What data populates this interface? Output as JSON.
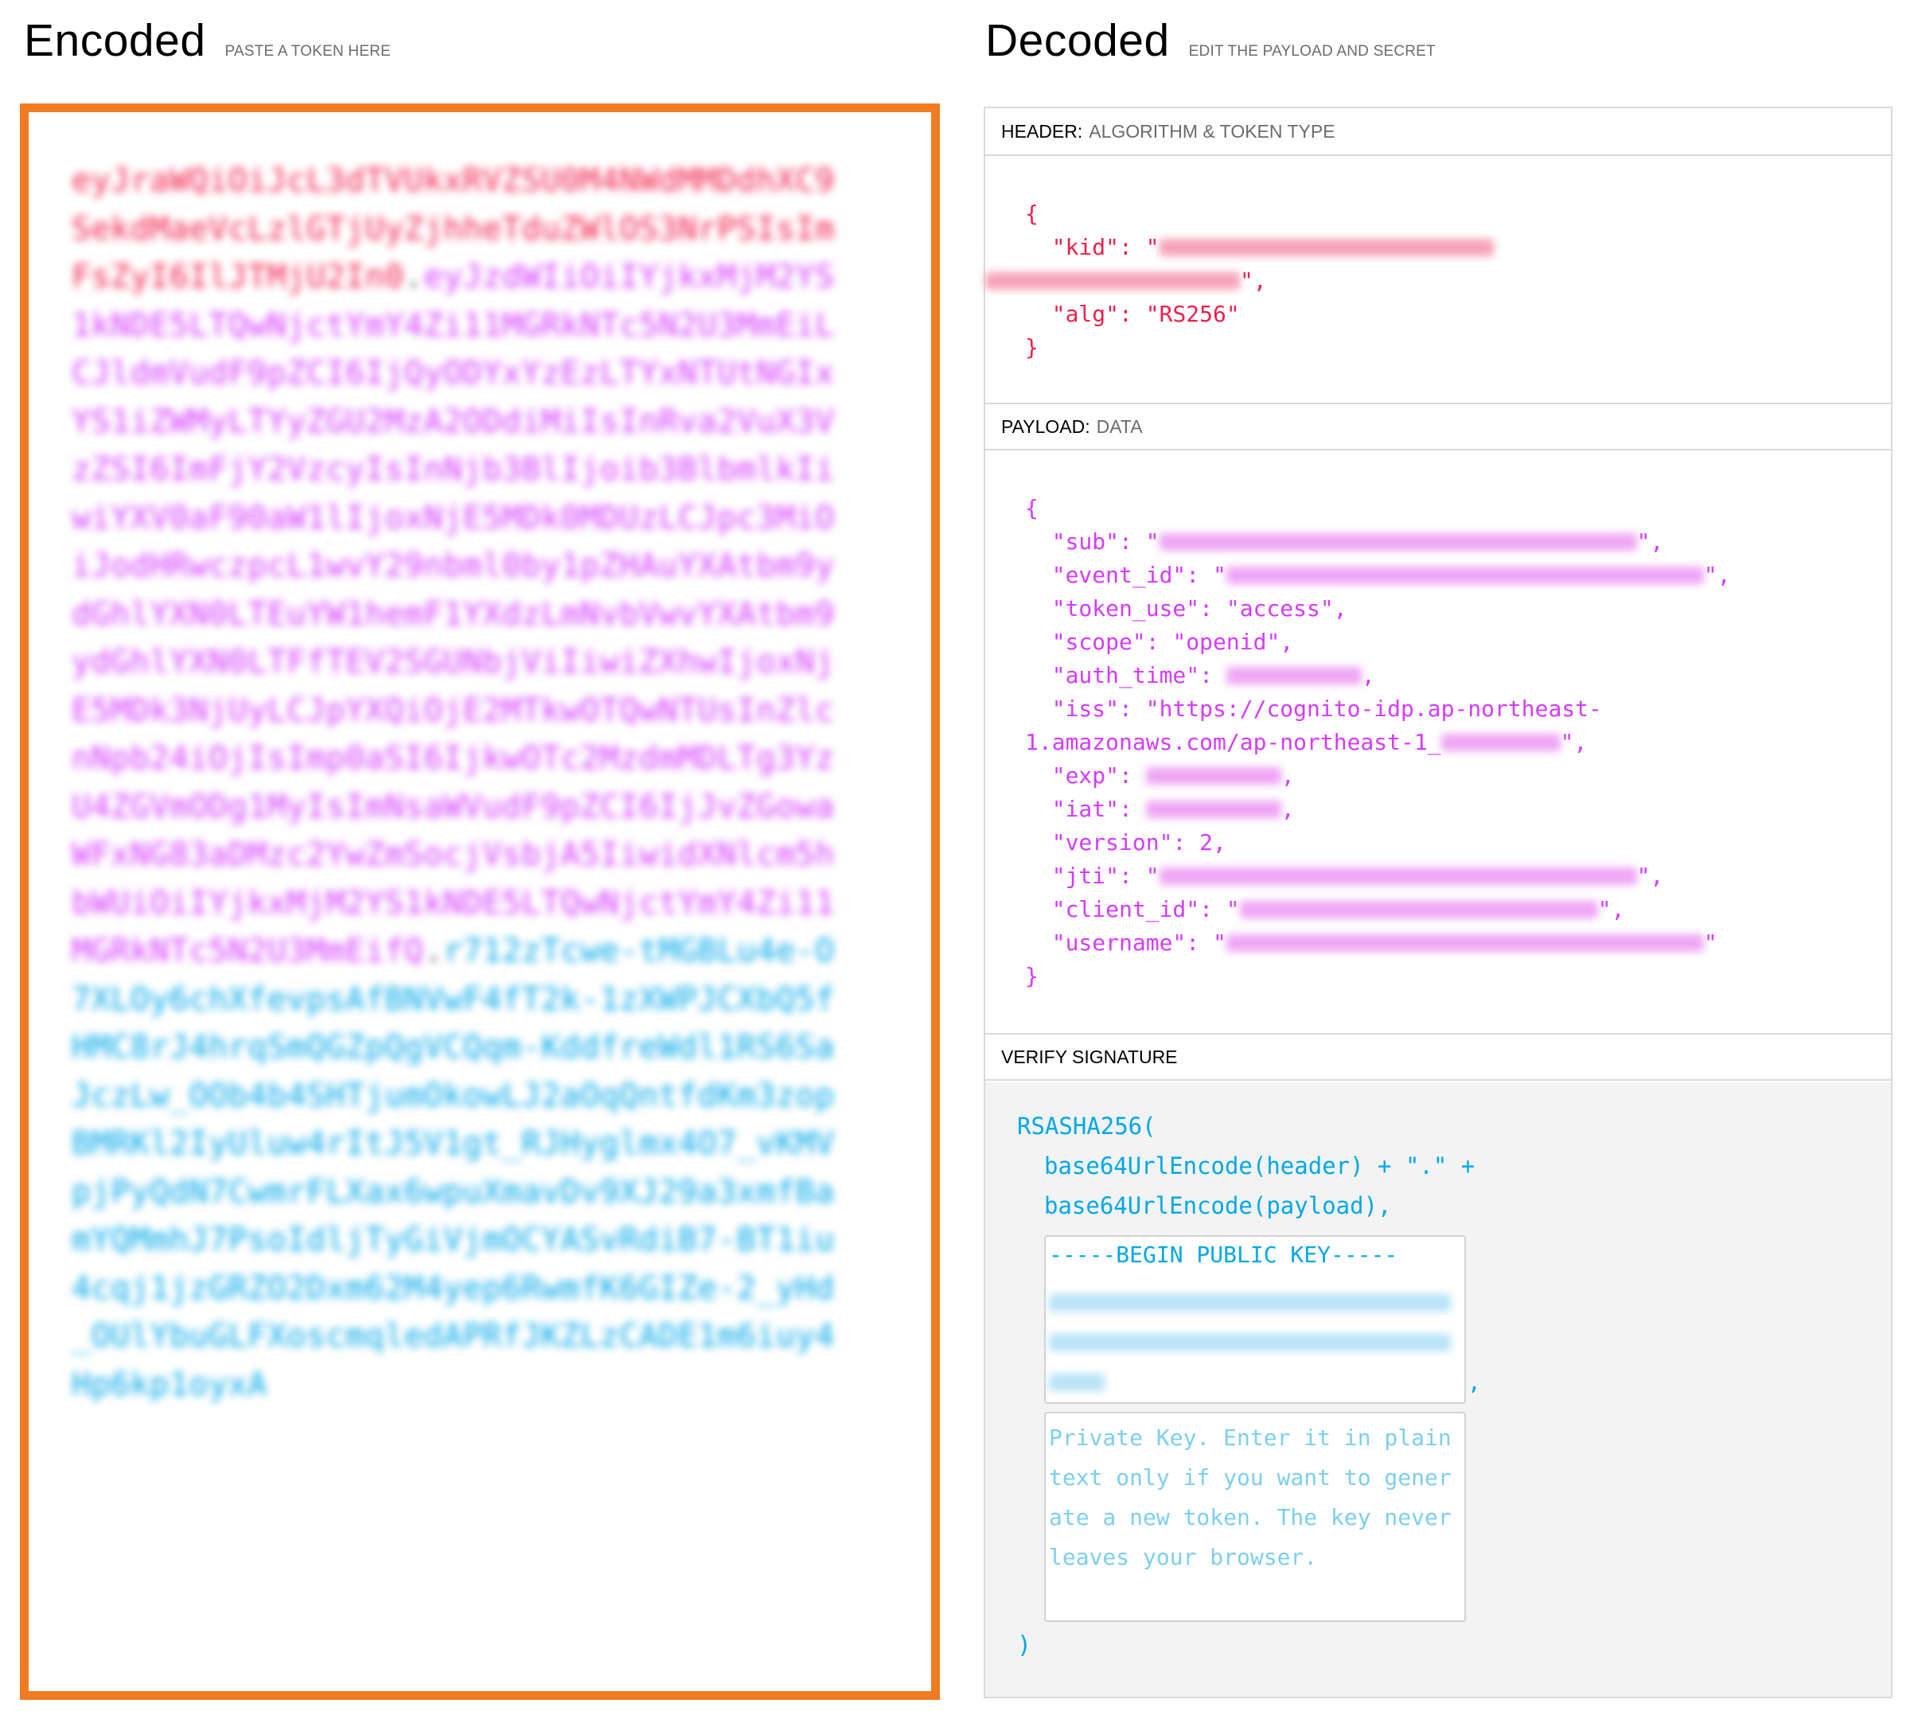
{
  "encoded": {
    "title": "Encoded",
    "subtitle": "PASTE A TOKEN HERE",
    "token_header": "eyJraWQiOiJcL3dTVUkxRVZSU0M4NWdMMDdhXC9SekdMaeVcLzlGTjUyZjhheTduZWlOS3NrPSIsImFsZyI6IlJTMjU2In0",
    "token_payload": "eyJzdWIiOiIYjkxMjM2YS1kNDE5LTQwNjctYmY4Zi11MGRkNTc5N2U3MmEiLCJldmVudF9pZCI6IjQyODYxYzEzLTYxNTUtNGIxYS1iZWMyLTYyZGU2MzA2ODdiMiIsInRva2VuX3VzZSI6ImFjY2VzcyIsInNjb3BlIjoib3BlbmlkIiwiYXV0aF90aW1lIjoxNjE5MDk0MDUzLCJpc3MiOiJodHRwczpcL1wvY29nbml0by1pZHAuYXAtbm9ydGhlYXN0LTEuYW1hemF1YXdzLmNvbVwvYXAtbm9ydGhlYXN0LTFfTEV2SGUNbjViIiwiZXhwIjoxNjE5MDk3NjUyLCJpYXQiOjE2MTkwOTQwNTUsInZlcnNpb24iOjIsImp0aSI6IjkwOTc2MzdmMDLTg3YzU4ZGVmODg1MyIsImNsaWVudF9pZCI6IjJvZGowaWFxNG83aDMzc2YwZmSocjVsbjA5IiwidXNlcm5hbWUiOiIYjkxMjM2YS1kNDE5LTQwNjctYmY4Zi11MGRkNTc5N2U3MmEifQ",
    "token_sig": "r712zTcwe-tMGBLu4e-O7XLOy6chXfevpsAfBNVwF4fT2k-1zXWPJCXbQ5fHMC8rJ4hrqSmQGZpQgVCQqm-KddfreWdl1RS6SaJczLw_OOb4b4SHTjumOkowLJ2aOqQntfdKm3zopBMRKl2IyUluw4rItJ5V1gt_RJHyglmx4O7_vKMVpjPyQdN7CwmrFLXax6wpuXmavDv9XJ29a3xmfBamYQMmhJ7PsoIdljTyGiVjmOCYASvRdiB7-BT1iu4cqj1jzGRZO2Dxm62M4yep6RwmfK6GIZe-2_yHd_OUlYbuGLFXoscmqledAPRfJKZLzCADE1m6iuy4Hp6kp1oyxA",
    "dot": "."
  },
  "decoded": {
    "title": "Decoded",
    "subtitle": "EDIT THE PAYLOAD AND SECRET",
    "header_section": {
      "label": "HEADER:",
      "desc": "ALGORITHM & TOKEN TYPE"
    },
    "payload_section": {
      "label": "PAYLOAD:",
      "desc": "DATA"
    },
    "verify_section": {
      "label": "VERIFY SIGNATURE"
    },
    "header_json": {
      "kid_key": "\"kid\"",
      "alg_key": "\"alg\"",
      "alg_value": "\"RS256\""
    },
    "payload_json": {
      "sub_key": "\"sub\"",
      "event_id_key": "\"event_id\"",
      "token_use_key": "\"token_use\"",
      "token_use_value": "\"access\"",
      "scope_key": "\"scope\"",
      "scope_value": "\"openid\"",
      "auth_time_key": "\"auth_time\"",
      "iss_key": "\"iss\"",
      "iss_value_part1": "\"https://cognito-idp.ap-northeast-",
      "iss_value_part2": "1.amazonaws.com/ap-northeast-1_",
      "exp_key": "\"exp\"",
      "iat_key": "\"iat\"",
      "version_key": "\"version\"",
      "version_value": "2",
      "jti_key": "\"jti\"",
      "client_id_key": "\"client_id\"",
      "username_key": "\"username\""
    },
    "verify": {
      "fn": "RSASHA256(",
      "line2": "base64UrlEncode(header) + \".\" +",
      "line3": "base64UrlEncode(payload),",
      "public_key_label": "-----BEGIN PUBLIC KEY-----",
      "private_key_placeholder": "Private Key. Enter it in plain text only if you want to generate a new token. The key never leaves your browser.",
      "close": ")"
    }
  },
  "colors": {
    "accent_border": "#f07b22",
    "header_red": "#ef1f4a",
    "payload_magenta": "#d63aff",
    "signature_blue": "#00a8e8"
  }
}
